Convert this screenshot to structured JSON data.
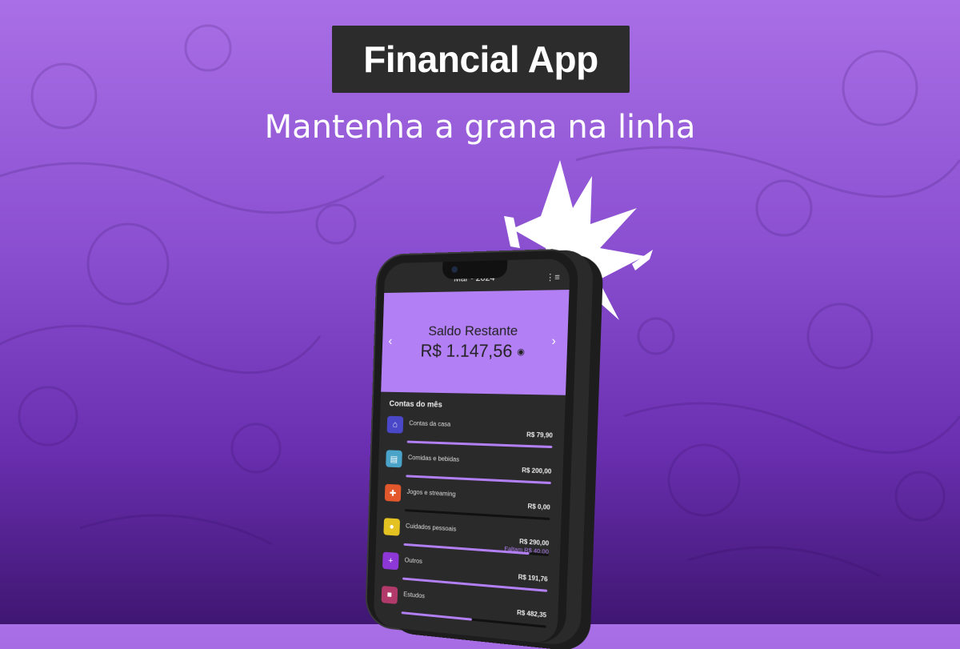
{
  "header": {
    "title": "Financial App",
    "subtitle": "Mantenha a grana na linha"
  },
  "app": {
    "month": "Mar - 2024",
    "balance_label": "Saldo Restante",
    "balance_value": "R$ 1.147,56",
    "section_title": "Contas do mês",
    "items": [
      {
        "label": "Contas da casa",
        "value": "R$ 79,90",
        "extra": "",
        "progress": 1.0,
        "color": "#4a47c8",
        "icon": "home-icon",
        "glyph": "⌂"
      },
      {
        "label": "Comidas e bebidas",
        "value": "R$ 200,00",
        "extra": "",
        "progress": 1.0,
        "color": "#4aa3c8",
        "icon": "food-icon",
        "glyph": "▤"
      },
      {
        "label": "Jogos e streaming",
        "value": "R$ 0,00",
        "extra": "",
        "progress": 0.0,
        "color": "#e2572b",
        "icon": "gamepad-icon",
        "glyph": "✚"
      },
      {
        "label": "Cuidados pessoais",
        "value": "R$ 290,00",
        "extra": "Faltam R$ 40,00",
        "progress": 0.87,
        "color": "#e3c221",
        "icon": "person-icon",
        "glyph": "●"
      },
      {
        "label": "Outros",
        "value": "R$ 191,76",
        "extra": "",
        "progress": 1.0,
        "color": "#8d38d6",
        "icon": "plus-icon",
        "glyph": "+"
      },
      {
        "label": "Estudos",
        "value": "R$ 482,35",
        "extra": "",
        "progress": 0.5,
        "color": "#b23a6a",
        "icon": "book-icon",
        "glyph": "■"
      }
    ]
  }
}
